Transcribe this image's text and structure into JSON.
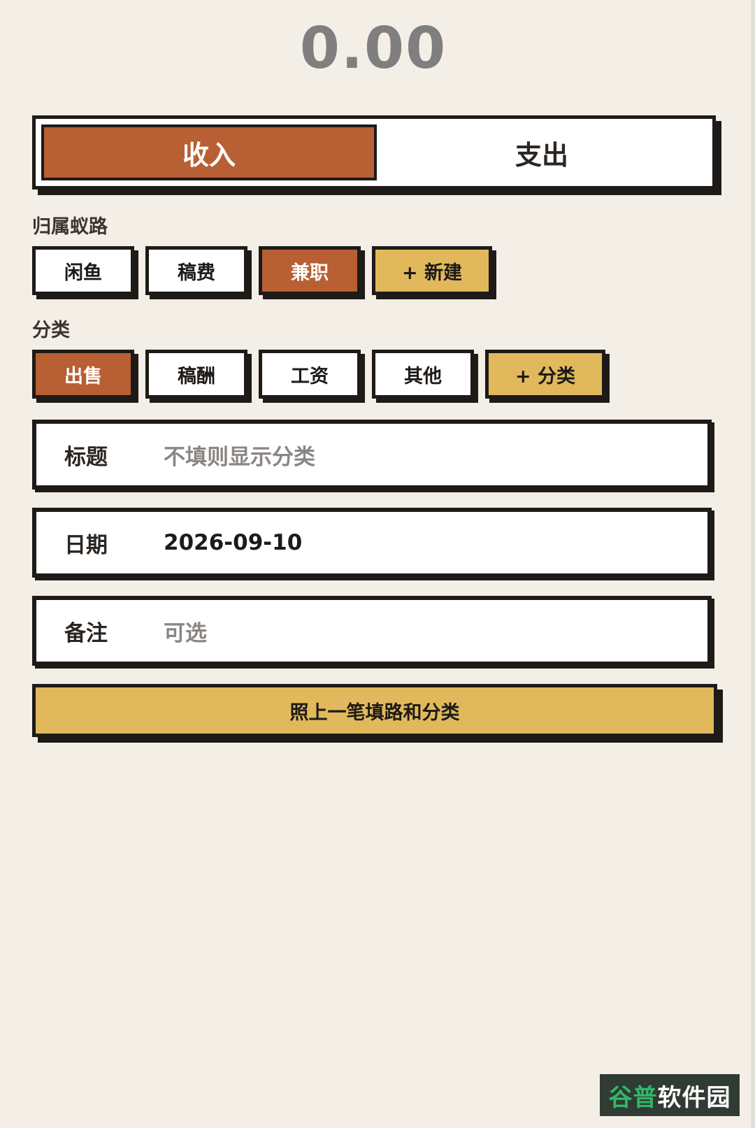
{
  "amount": "0.00",
  "type_toggle": {
    "income": "收入",
    "expense": "支出",
    "selected": "收入"
  },
  "route_section": {
    "label": "归属蚁路",
    "chips": [
      "闲鱼",
      "稿费",
      "兼职"
    ],
    "selected": "兼职",
    "add_label": "+ 新建"
  },
  "category_section": {
    "label": "分类",
    "chips": [
      "出售",
      "稿酬",
      "工资",
      "其他"
    ],
    "selected": "出售",
    "add_label": "+ 分类"
  },
  "fields": {
    "title": {
      "label": "标题",
      "placeholder": "不填则显示分类"
    },
    "date": {
      "label": "日期",
      "value": "2026-09-10"
    },
    "note": {
      "label": "备注",
      "placeholder": "可选"
    }
  },
  "repeat_button": "照上一笔填路和分类",
  "watermark": {
    "part1": "谷普",
    "part2": "软件园"
  },
  "colors": {
    "background": "#f4efe6",
    "accent": "#b85f33",
    "add": "#e1b95c",
    "border": "#1d1a17"
  }
}
